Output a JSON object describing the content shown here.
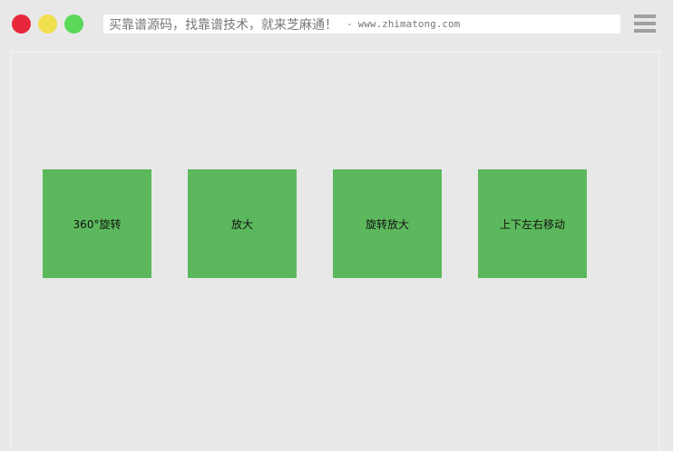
{
  "window": {
    "traffic_lights": {
      "close_color": "#e8283a",
      "minimize_color": "#f0e050",
      "maximize_color": "#5ad85a"
    },
    "address_bar": {
      "main_text": "买靠谱源码，找靠谱技术，就来芝麻通！",
      "separator": "-",
      "url": "www.zhimatong.com"
    },
    "menu_icon": "hamburger-menu-icon"
  },
  "demo": {
    "box_color": "#5cb85c",
    "boxes": [
      {
        "label": "360°旋转"
      },
      {
        "label": "放大"
      },
      {
        "label": "旋转放大"
      },
      {
        "label": "上下左右移动"
      }
    ]
  }
}
